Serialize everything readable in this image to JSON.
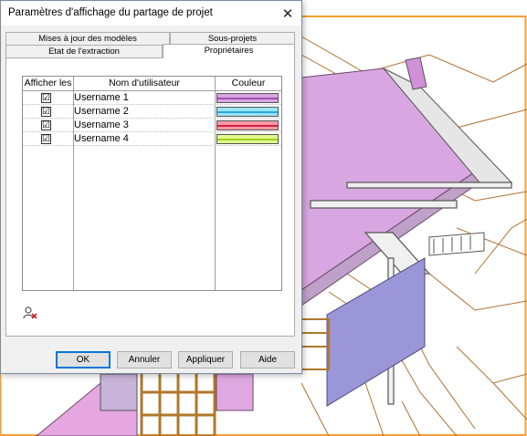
{
  "dialog": {
    "title": "Paramètres d'affichage du partage de projet",
    "close_icon": "close-icon"
  },
  "tabs": {
    "row1": [
      "Mises à jour des modèles",
      "Sous-projets"
    ],
    "row2": [
      "Etat de l'extraction",
      "Propriétaires"
    ],
    "active": "Propriétaires"
  },
  "grid": {
    "headers": [
      "Afficher les",
      "Nom d'utilisateur",
      "Couleur"
    ],
    "rows": [
      {
        "checked": "☑",
        "user": "Username 1",
        "color": "#c879d8"
      },
      {
        "checked": "☑",
        "user": "Username 2",
        "color": "#5fd3f0"
      },
      {
        "checked": "☑",
        "user": "Username 3",
        "color": "#f0506e"
      },
      {
        "checked": "☑",
        "user": "Username 4",
        "color": "#c8f050"
      }
    ]
  },
  "icons": {
    "remove_user": "remove-user-icon"
  },
  "buttons": {
    "ok": "OK",
    "cancel": "Annuler",
    "apply": "Appliquer",
    "help": "Aide"
  },
  "colors": {
    "accent": "#0078d7",
    "background_frame": "#f59a30",
    "roof": "#d8a6e0"
  }
}
